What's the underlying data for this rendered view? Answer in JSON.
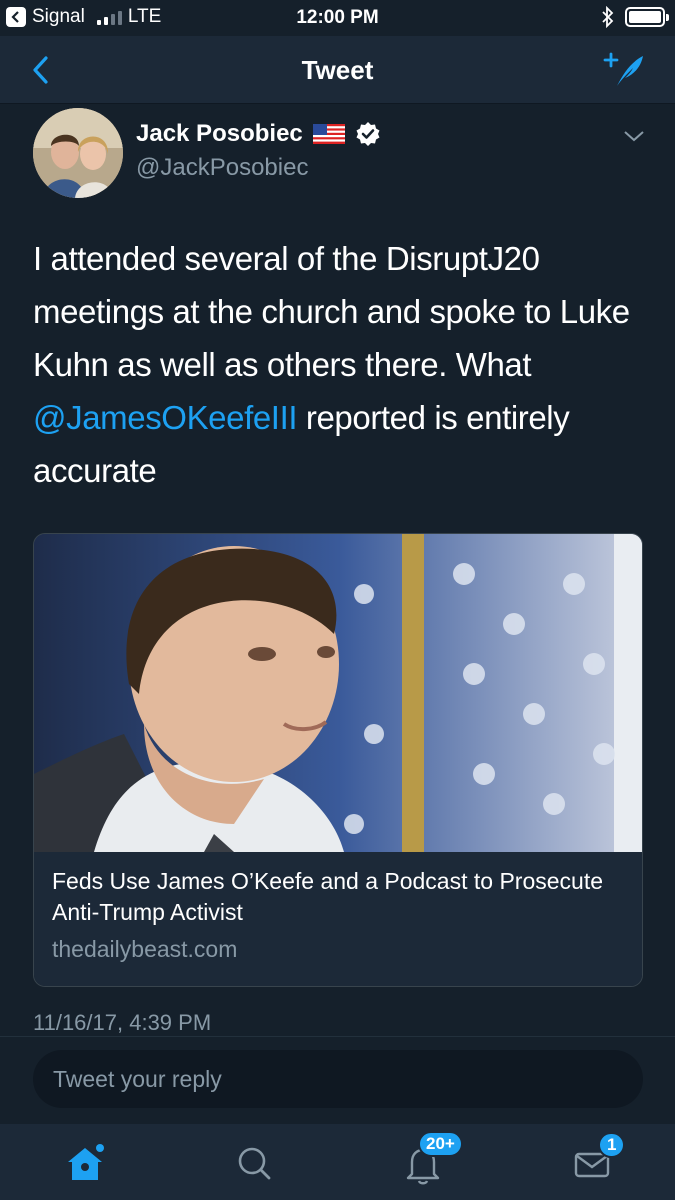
{
  "status_bar": {
    "back_app": "Signal",
    "network": "LTE",
    "time": "12:00 PM"
  },
  "nav": {
    "title": "Tweet"
  },
  "tweet": {
    "display_name": "Jack Posobiec",
    "handle": "@JackPosobiec",
    "text_before_mention": "I attended several of the DisruptJ20 meetings at the church and spoke to Luke Kuhn as well as others there. What ",
    "mention": "@JamesOKeefeIII",
    "text_after_mention": " reported is entirely accurate",
    "timestamp": "11/16/17, 4:39 PM"
  },
  "card": {
    "title": "Feds Use James O’Keefe and a Podcast to Prosecute Anti-Trump Activist",
    "domain": "thedailybeast.com"
  },
  "reply": {
    "placeholder": "Tweet your reply"
  },
  "tabs": {
    "notifications_badge": "20+",
    "messages_badge": "1"
  },
  "colors": {
    "background": "#15202b",
    "nav_background": "#1c2938",
    "accent": "#1da1f2",
    "secondary_text": "#8899a6"
  }
}
